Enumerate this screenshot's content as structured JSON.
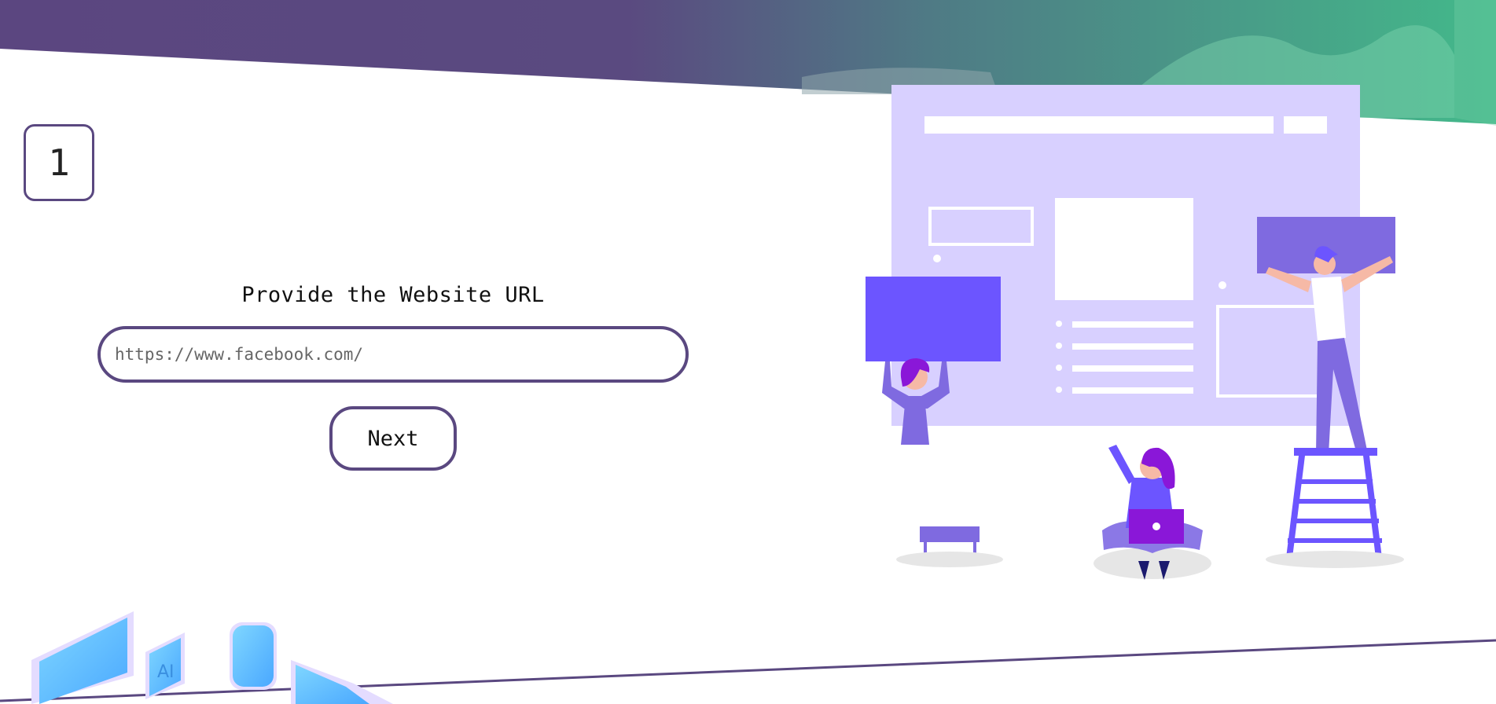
{
  "step": {
    "number": "1"
  },
  "form": {
    "title": "Provide the Website URL",
    "url_placeholder": "https://www.facebook.com/",
    "url_value": "",
    "next_label": "Next"
  },
  "decor": {
    "header_icon": "gradient-wave-banner",
    "illustration_icon": "website-builders-illustration",
    "ai_icon": "ai-cube-illustration"
  },
  "colors": {
    "accent": "#5a4880",
    "gradient_start": "#5b4680",
    "gradient_end": "#43b98a",
    "illustration_light": "#d8d0ff",
    "illustration_purple": "#6c55ff"
  }
}
